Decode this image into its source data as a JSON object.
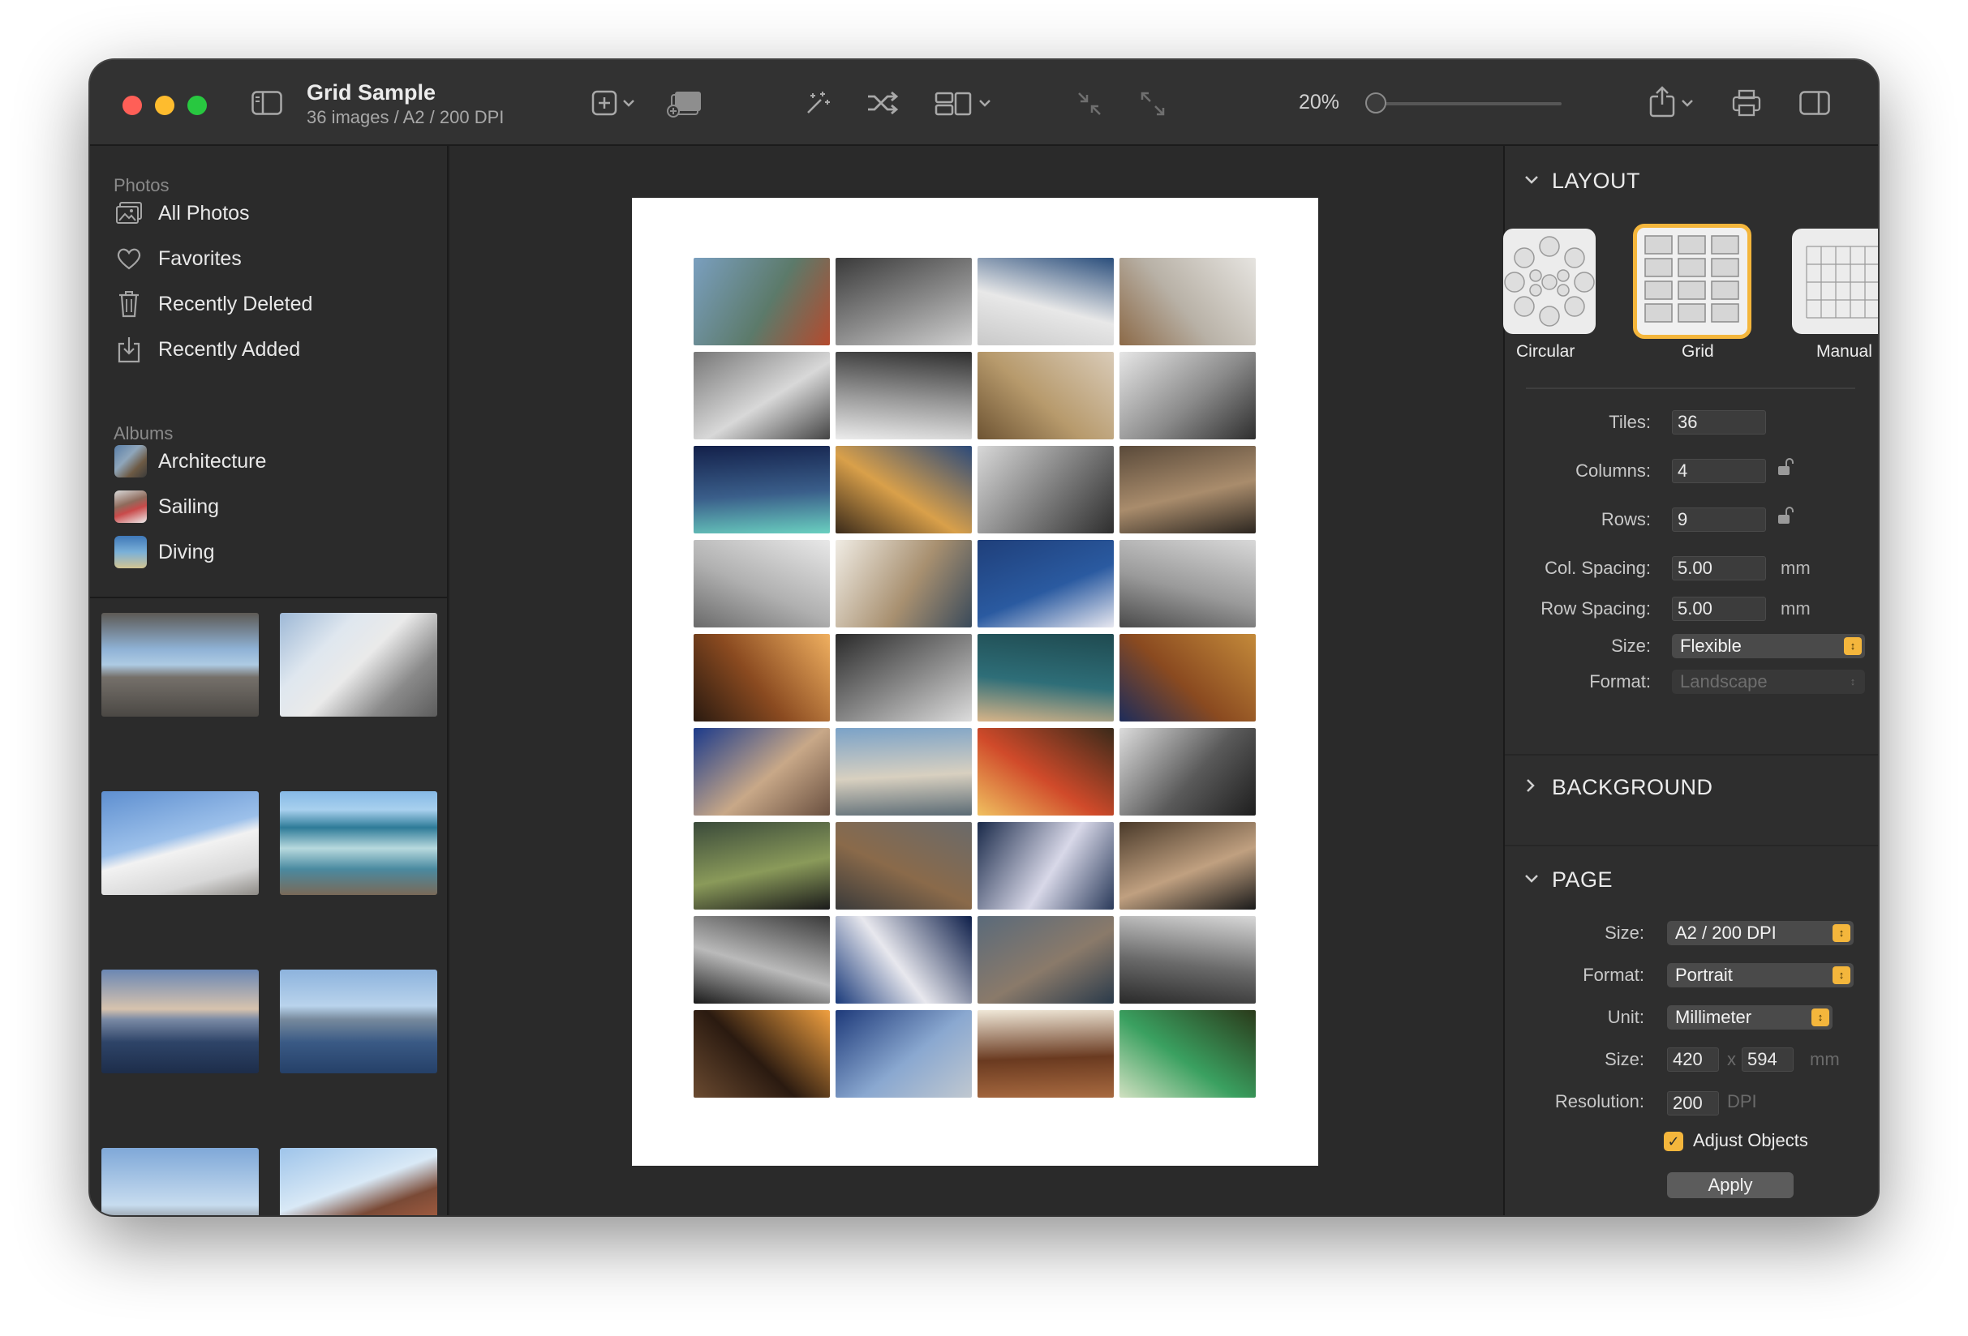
{
  "window": {
    "title": "Grid Sample",
    "subtitle": "36 images / A2 / 200 DPI"
  },
  "toolbar": {
    "zoom_label": "20%",
    "zoom_value": 0.0,
    "icons": [
      "sidebar-toggle-icon",
      "add-icon",
      "chevron-down-icon",
      "add-slideshow-icon",
      "magic-wand-icon",
      "shuffle-icon",
      "layout-icon",
      "shrink-icon",
      "expand-icon",
      "share-icon",
      "print-icon",
      "inspector-toggle-icon"
    ]
  },
  "sidebar": {
    "photos_header": "Photos",
    "photo_items": [
      {
        "label": "All Photos",
        "icon": "photos-icon"
      },
      {
        "label": "Favorites",
        "icon": "heart-icon"
      },
      {
        "label": "Recently Deleted",
        "icon": "trash-icon"
      },
      {
        "label": "Recently Added",
        "icon": "download-tray-icon"
      }
    ],
    "albums_header": "Albums",
    "albums": [
      {
        "label": "Architecture"
      },
      {
        "label": "Sailing"
      },
      {
        "label": "Diving"
      }
    ]
  },
  "inspector": {
    "layout": {
      "header": "LAYOUT",
      "options": [
        {
          "label": "Circular",
          "selected": false
        },
        {
          "label": "Grid",
          "selected": true
        },
        {
          "label": "Manual",
          "selected": false
        }
      ],
      "tiles_label": "Tiles:",
      "tiles_value": "36",
      "columns_label": "Columns:",
      "columns_value": "4",
      "rows_label": "Rows:",
      "rows_value": "9",
      "col_spacing_label": "Col. Spacing:",
      "col_spacing_value": "5.00",
      "row_spacing_label": "Row Spacing:",
      "row_spacing_value": "5.00",
      "spacing_unit": "mm",
      "size_label": "Size:",
      "size_value": "Flexible",
      "format_label": "Format:",
      "format_value": "Landscape"
    },
    "background": {
      "header": "BACKGROUND"
    },
    "page": {
      "header": "PAGE",
      "size_label": "Size:",
      "size_value": "A2 / 200 DPI",
      "format_label": "Format:",
      "format_value": "Portrait",
      "unit_label": "Unit:",
      "unit_value": "Millimeter",
      "dims_label": "Size:",
      "width_value": "420",
      "dims_separator": "x",
      "height_value": "594",
      "dims_unit": "mm",
      "resolution_label": "Resolution:",
      "resolution_value": "200",
      "resolution_unit": "DPI",
      "adjust_label": "Adjust Objects",
      "adjust_checked": true,
      "apply_label": "Apply"
    }
  },
  "colors": {
    "accent": "#f4b63c",
    "window_bg": "#262626",
    "toolbar_bg": "#323232",
    "sidebar_bg": "#2b2b2b",
    "inspector_bg": "#2e2e2e",
    "paper": "#ffffff"
  }
}
